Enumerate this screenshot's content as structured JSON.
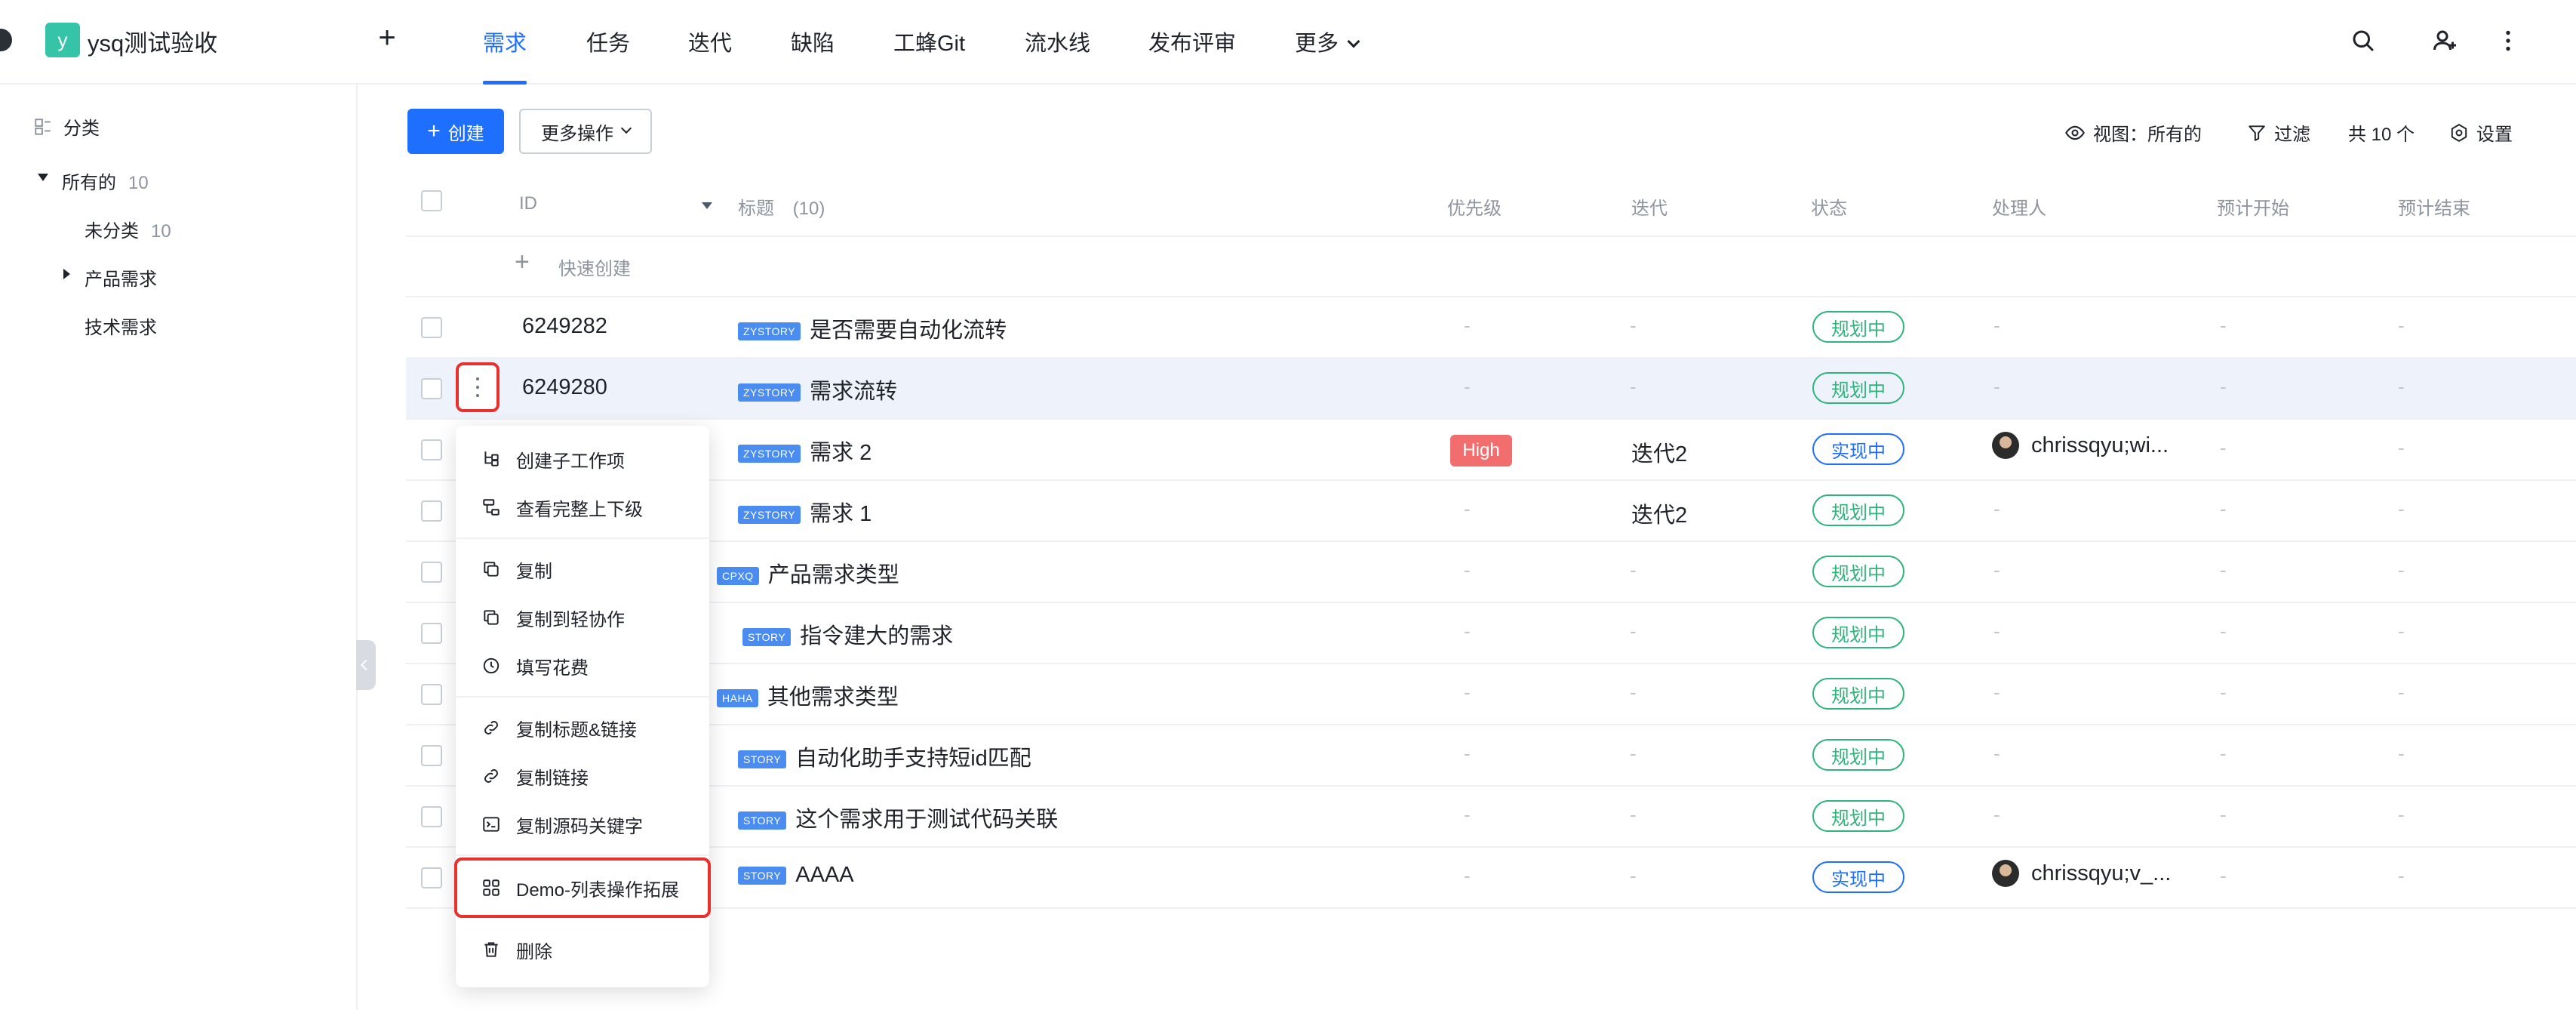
{
  "app": {
    "avatar_letter": "y",
    "project_name": "ysq测试验收",
    "plus": "+"
  },
  "nav": {
    "tabs": [
      "需求",
      "任务",
      "迭代",
      "缺陷",
      "工蜂Git",
      "流水线",
      "发布评审",
      "更多"
    ],
    "active_tab": "需求"
  },
  "sidebar": {
    "header": "分类",
    "all_label": "所有的",
    "all_count": "10",
    "items": [
      {
        "label": "未分类",
        "count": "10"
      },
      {
        "label": "产品需求",
        "count": ""
      },
      {
        "label": "技术需求",
        "count": ""
      }
    ]
  },
  "toolbar": {
    "create_label": "创建",
    "more_ops_label": "更多操作",
    "view_label": "视图：所有的",
    "filter_label": "过滤",
    "total_label": "共 10 个",
    "settings_label": "设置"
  },
  "table": {
    "headers": {
      "id": "ID",
      "title": "标题",
      "title_count": "(10)",
      "priority": "优先级",
      "iteration": "迭代",
      "status": "状态",
      "assignee": "处理人",
      "start": "预计开始",
      "end": "预计结束"
    },
    "quick_create": "快速创建",
    "dash": "-",
    "rows": [
      {
        "id": "6249282",
        "tag": "ZYSTORY",
        "title": "是否需要自动化流转",
        "priority": "",
        "iteration": "",
        "status": "规划中",
        "assignee": ""
      },
      {
        "id": "6249280",
        "tag": "ZYSTORY",
        "title": "需求流转",
        "priority": "",
        "iteration": "",
        "status": "规划中",
        "assignee": ""
      },
      {
        "id": "",
        "tag": "ZYSTORY",
        "title": "需求 2",
        "priority": "High",
        "iteration": "迭代2",
        "status": "实现中",
        "assignee": "chrissqyu;wi..."
      },
      {
        "id": "",
        "tag": "ZYSTORY",
        "title": "需求 1",
        "priority": "",
        "iteration": "迭代2",
        "status": "规划中",
        "assignee": ""
      },
      {
        "id": "",
        "tag": "CPXQ",
        "title": "产品需求类型",
        "priority": "",
        "iteration": "",
        "status": "规划中",
        "assignee": ""
      },
      {
        "id": "",
        "tag": "STORY",
        "title": "指令建大的需求",
        "priority": "",
        "iteration": "",
        "status": "规划中",
        "assignee": ""
      },
      {
        "id": "",
        "tag": "HAHA",
        "title": "其他需求类型",
        "priority": "",
        "iteration": "",
        "status": "规划中",
        "assignee": ""
      },
      {
        "id": "",
        "tag": "STORY",
        "title": "自动化助手支持短id匹配",
        "priority": "",
        "iteration": "",
        "status": "规划中",
        "assignee": ""
      },
      {
        "id": "",
        "tag": "STORY",
        "title": "这个需求用于测试代码关联",
        "priority": "",
        "iteration": "",
        "status": "规划中",
        "assignee": ""
      },
      {
        "id": "",
        "tag": "STORY",
        "title": "AAAA",
        "priority": "",
        "iteration": "",
        "status": "实现中",
        "assignee": "chrissqyu;v_..."
      }
    ]
  },
  "context_menu": {
    "items": [
      {
        "label": "创建子工作项",
        "icon": "subtask-icon"
      },
      {
        "label": "查看完整上下级",
        "icon": "hierarchy-icon"
      },
      {
        "label": "复制",
        "icon": "copy-icon"
      },
      {
        "label": "复制到轻协作",
        "icon": "copy-icon"
      },
      {
        "label": "填写花费",
        "icon": "clock-icon"
      },
      {
        "label": "复制标题&链接",
        "icon": "link-icon"
      },
      {
        "label": "复制链接",
        "icon": "link-icon"
      },
      {
        "label": "复制源码关键字",
        "icon": "terminal-icon"
      },
      {
        "label": "Demo-列表操作拓展",
        "icon": "grid-icon"
      },
      {
        "label": "删除",
        "icon": "trash-icon"
      }
    ]
  },
  "colors": {
    "accent": "#1f6fff",
    "status_planning": "#2fb47c",
    "priority_high": "#f26d6d",
    "highlight": "#e8302d"
  }
}
